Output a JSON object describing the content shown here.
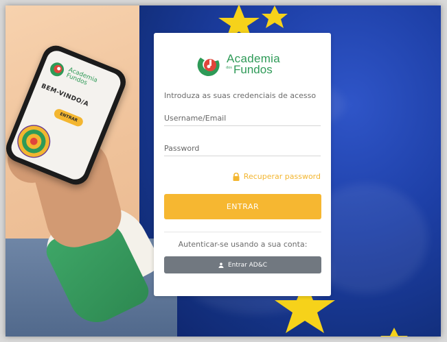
{
  "logo": {
    "line1": "Academia",
    "small": "dos",
    "line2": "Fundos"
  },
  "phone": {
    "logo_line1": "Academia",
    "logo_line2": "Fundos",
    "welcome": "BEM-VINDO/A",
    "button": "ENTRAR"
  },
  "login": {
    "subtitle": "Introduza as suas credenciais de acesso",
    "username_placeholder": "Username/Email",
    "password_placeholder": "Password",
    "recover_label": "Recuperar password",
    "submit_label": "ENTRAR",
    "alt_text": "Autenticar-se usando a sua conta:",
    "adc_label": "Entrar AD&C"
  },
  "colors": {
    "accent": "#f6b731",
    "brand_green": "#2e9a57",
    "brand_red": "#e0453b",
    "secondary_button": "#717880",
    "flag_blue": "#1d3fa6",
    "star_yellow": "#f6d21a"
  },
  "icons": {
    "logo": "academia-fundos-logo",
    "recover": "lock-icon",
    "adc": "user-icon"
  }
}
